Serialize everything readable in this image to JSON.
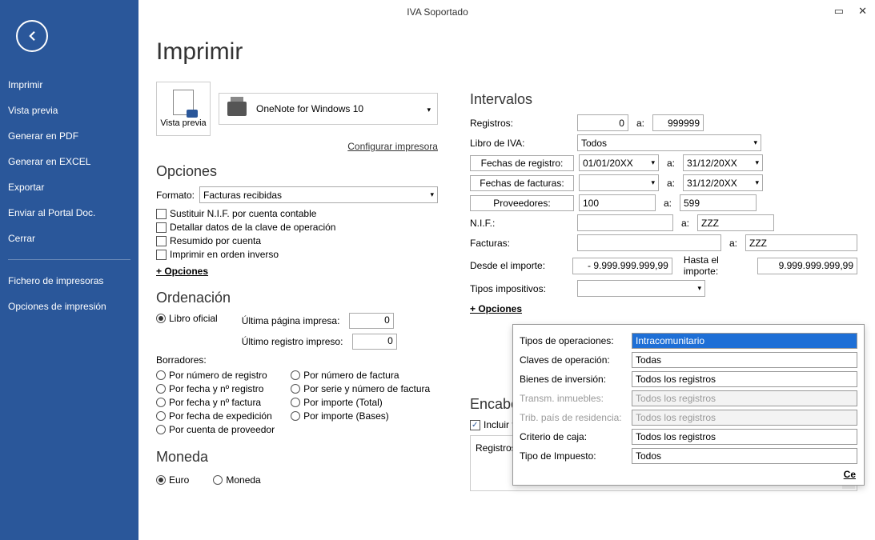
{
  "title": "IVA Soportado",
  "sidebar": {
    "items": [
      "Imprimir",
      "Vista previa",
      "Generar en PDF",
      "Generar en EXCEL",
      "Exportar",
      "Enviar al Portal Doc.",
      "Cerrar"
    ],
    "bottom": [
      "Fichero de impresoras",
      "Opciones de impresión"
    ]
  },
  "page_heading": "Imprimir",
  "vista_previa_label": "Vista previa",
  "printer_name": "OneNote for Windows 10",
  "config_printer": "Configurar impresora",
  "opciones": {
    "heading": "Opciones",
    "formato_label": "Formato:",
    "formato_value": "Facturas recibidas",
    "chk_sustituir": "Sustituir N.I.F. por cuenta contable",
    "chk_detallar": "Detallar datos de la clave de operación",
    "chk_resumido": "Resumido por cuenta",
    "chk_inverso": "Imprimir en orden inverso",
    "plus": "+ Opciones"
  },
  "ordenacion": {
    "heading": "Ordenación",
    "libro_oficial": "Libro oficial",
    "ultima_pagina_label": "Última página impresa:",
    "ultima_pagina_value": "0",
    "ultimo_registro_label": "Último registro impreso:",
    "ultimo_registro_value": "0",
    "borradores_label": "Borradores:",
    "r_num_registro": "Por número de registro",
    "r_num_factura": "Por número de factura",
    "r_fecha_registro": "Por fecha y nº registro",
    "r_serie_factura": "Por serie y número de factura",
    "r_fecha_factura": "Por fecha y nº factura",
    "r_importe_total": "Por importe (Total)",
    "r_fecha_exped": "Por fecha de expedición",
    "r_importe_bases": "Por importe (Bases)",
    "r_cuenta_prov": "Por cuenta de proveedor"
  },
  "moneda": {
    "heading": "Moneda",
    "euro": "Euro",
    "moneda": "Moneda"
  },
  "intervalos": {
    "heading": "Intervalos",
    "registros_label": "Registros:",
    "registros_from": "0",
    "registros_to": "999999",
    "libro_iva_label": "Libro de IVA:",
    "libro_iva_value": "Todos",
    "fechas_registro_btn": "Fechas de registro:",
    "fechas_registro_from": "01/01/20XX",
    "fechas_registro_to": "31/12/20XX",
    "fechas_facturas_btn": "Fechas de facturas:",
    "fechas_facturas_from": "",
    "fechas_facturas_to": "31/12/20XX",
    "proveedores_btn": "Proveedores:",
    "proveedores_from": "100",
    "proveedores_to": "599",
    "nif_label": "N.I.F.:",
    "nif_from": "",
    "nif_to": "ZZZ",
    "facturas_label": "Facturas:",
    "facturas_from": "",
    "facturas_to": "ZZZ",
    "desde_importe_label": "Desde el importe:",
    "desde_importe_value": "-   9.999.999.999,99",
    "hasta_importe_label": "Hasta el importe:",
    "hasta_importe_value": "9.999.999.999,99",
    "tipos_impositivos_label": "Tipos impositivos:",
    "tipos_impositivos_value": "",
    "plus": "+ Opciones",
    "a_sep": "a:"
  },
  "encabezamiento": {
    "heading": "Encabez",
    "incluir_texto": "Incluir textc",
    "registros_des": "Registros des"
  },
  "popup": {
    "tipos_operaciones_label": "Tipos de operaciones:",
    "tipos_operaciones_value": "Intracomunitario",
    "claves_label": "Claves de operación:",
    "claves_value": "Todas",
    "bienes_label": "Bienes de inversión:",
    "bienes_value": "Todos los registros",
    "transm_label": "Transm. inmuebles:",
    "transm_value": "Todos los registros",
    "trib_label": "Trib. país de residencia:",
    "trib_value": "Todos los registros",
    "criterio_label": "Criterio de caja:",
    "criterio_value": "Todos los registros",
    "tipo_impuesto_label": "Tipo de Impuesto:",
    "tipo_impuesto_value": "Todos",
    "cerrar": "Ce"
  }
}
